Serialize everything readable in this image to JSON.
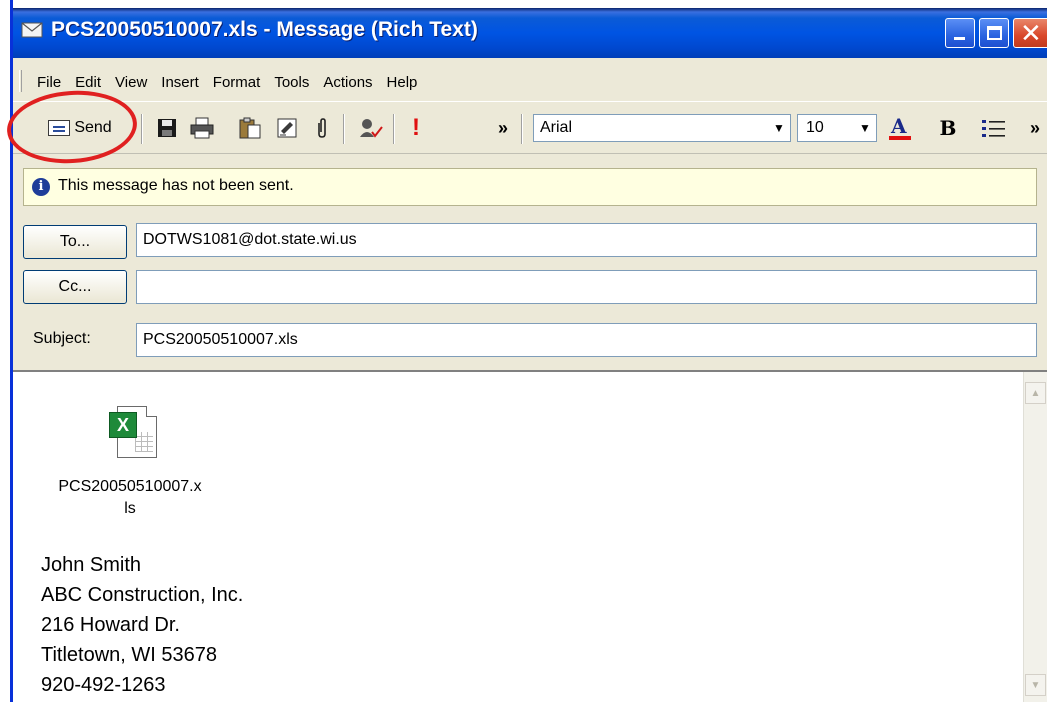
{
  "window": {
    "title": "PCS20050510007.xls - Message (Rich Text)"
  },
  "menu": {
    "items": [
      "File",
      "Edit",
      "View",
      "Insert",
      "Format",
      "Tools",
      "Actions",
      "Help"
    ]
  },
  "toolbar": {
    "send_label": "Send",
    "font_name": "Arial",
    "font_size": "10",
    "overflow_glyph": "»",
    "icons": [
      "save-icon",
      "print-icon",
      "paste-icon",
      "signature-icon",
      "attach-icon",
      "check-names-icon",
      "importance-high-icon",
      "font-color-icon",
      "bold-icon",
      "bullets-icon"
    ]
  },
  "infobar": {
    "text": "This message has not been sent."
  },
  "fields": {
    "to_button": "To...",
    "to_value": "DOTWS1081@dot.state.wi.us",
    "cc_button": "Cc...",
    "cc_value": "",
    "subject_label": "Subject:",
    "subject_value": "PCS20050510007.xls"
  },
  "body": {
    "attachment_name_line1": "PCS20050510007.x",
    "attachment_name_line2": "ls",
    "signature": [
      "John Smith",
      "ABC Construction, Inc.",
      "216 Howard Dr.",
      "Titletown, WI 53678",
      "920-492-1263"
    ]
  },
  "colors": {
    "titlebar": "#0054e3",
    "annotation_circle": "#e02020",
    "infobar_bg": "#ffffe1"
  }
}
